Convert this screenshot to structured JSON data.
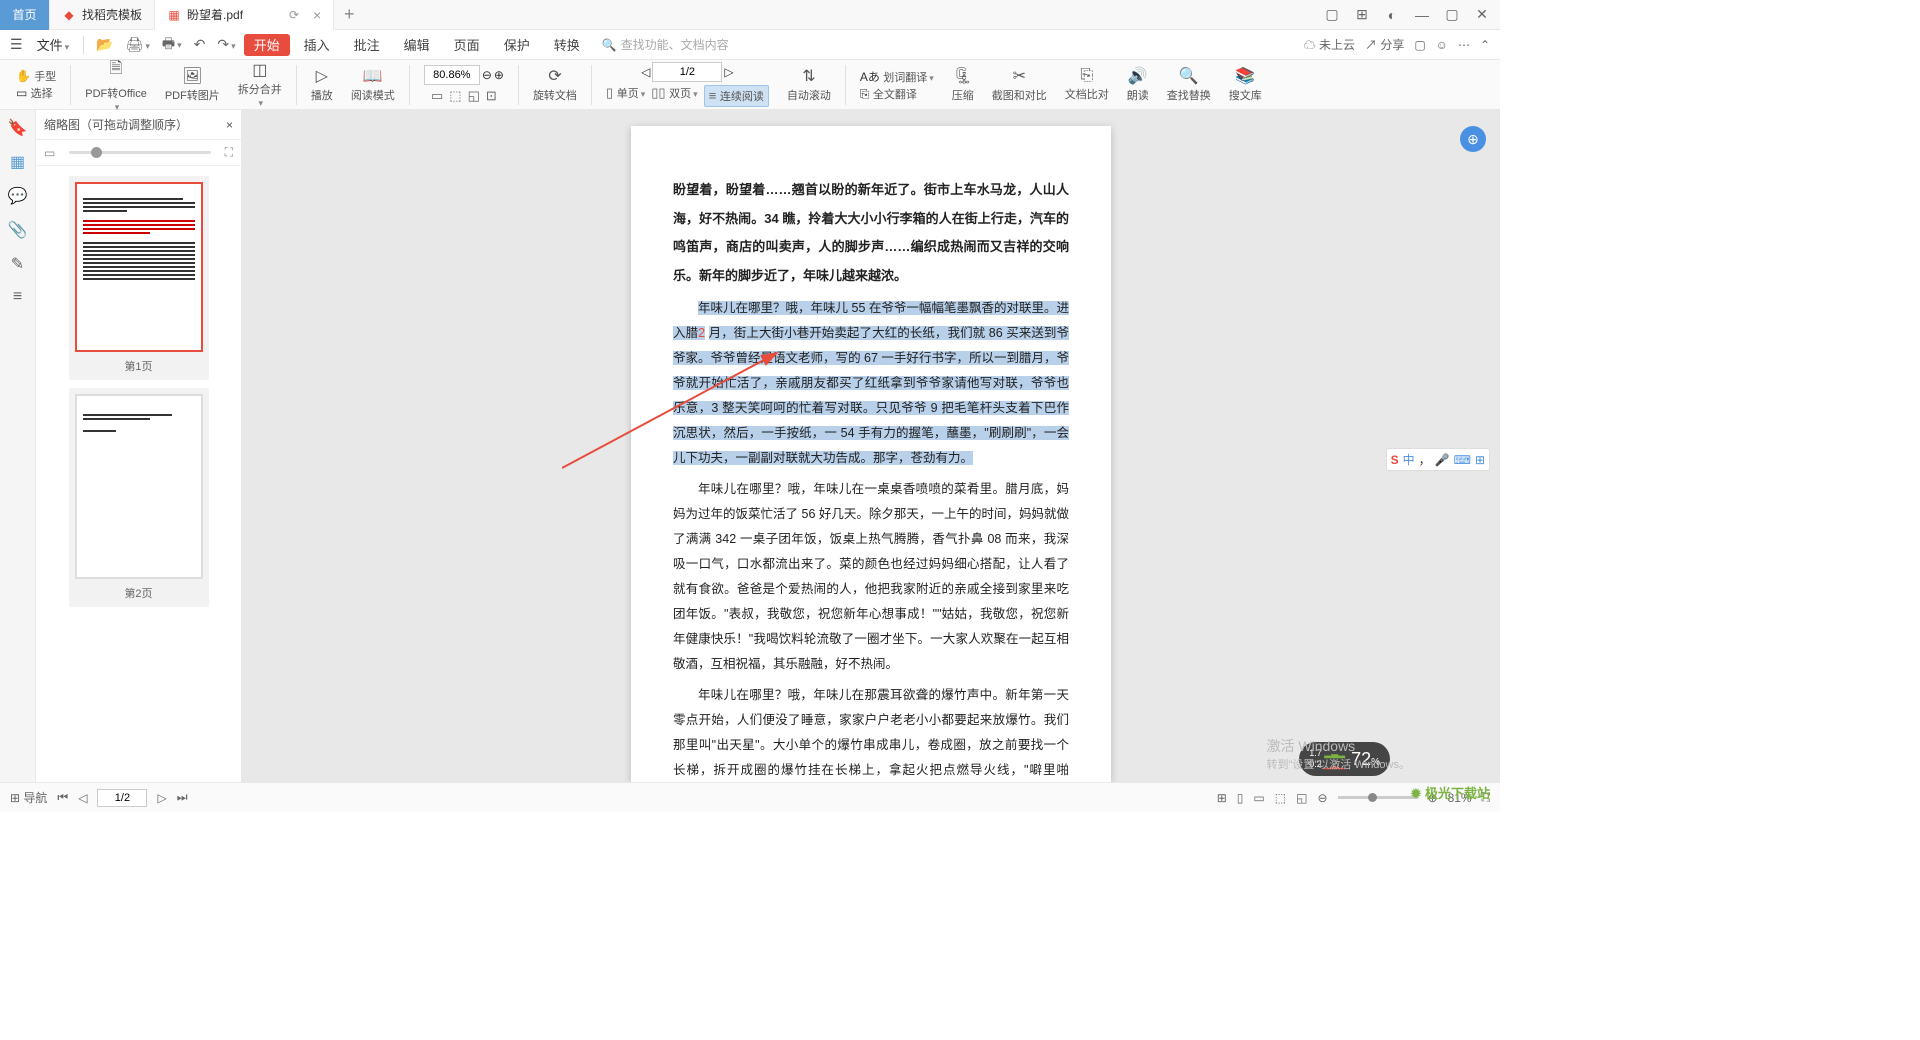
{
  "tabs": {
    "home": "首页",
    "template": "找稻壳模板",
    "doc": "盼望着.pdf"
  },
  "file_label": "文件",
  "menus": {
    "start": "开始",
    "insert": "插入",
    "review": "批注",
    "edit": "编辑",
    "page": "页面",
    "protect": "保护",
    "convert": "转换"
  },
  "search_placeholder": "查找功能、文档内容",
  "right": {
    "cloud": "未上云",
    "share": "分享"
  },
  "tools": {
    "hand": "手型",
    "select": "选择",
    "pdf2office": "PDF转Office",
    "pdf2img": "PDF转图片",
    "split": "拆分合并",
    "play": "播放",
    "readmode": "阅读模式",
    "zoom": "80.86%",
    "rotate": "旋转文档",
    "single": "单页",
    "double": "双页",
    "continuous": "连续阅读",
    "autoscroll": "自动滚动",
    "wordtrans": "划词翻译",
    "fulltrans": "全文翻译",
    "compress": "压缩",
    "screenshot": "截图和对比",
    "textcompare": "文档比对",
    "read": "朗读",
    "findreplace": "查找替换",
    "searchlib": "搜文库",
    "page": "1/2"
  },
  "thumb": {
    "title": "缩略图（可拖动调整顺序）",
    "p1": "第1页",
    "p2": "第2页"
  },
  "doc": {
    "p1": "盼望着，盼望着……翘首以盼的新年近了。街市上车水马龙，人山人海，好不热闹。34 瞧，拎着大大小小行李箱的人在街上行走，汽车的鸣笛声，商店的叫卖声，人的脚步声……编织成热闹而又吉祥的交响乐。新年的脚步近了，年味儿越来越浓。",
    "p2a": "年味儿在哪里？哦，年味儿 55 在爷爷一幅幅笔墨飘香的对联里。进入腊",
    "p2b": "月，街上大街小巷开始卖起了大红的长纸，我们就 86 买来送到爷爷家。爷爷曾经是语文老师，写的 67 一手好行书字，所以一到腊月，爷爷就开始忙活了，亲戚朋友都买了红纸拿到爷爷家请他写对联，爷爷也乐意，3 整天笑呵呵的忙着写对联。只见爷爷 9 把毛笔杆头支着下巴作沉思状，然后，一手按纸，一 54 手有力的握笔，蘸墨，\"刷刷刷\"，一会儿下功夫，一副副对联就大功告成。那字，苍劲有力。",
    "p2_hi_nums": {
      "a": "2",
      "b": "86",
      "c": "67",
      "d": "3",
      "e": "9",
      "f": "54"
    },
    "p3": "年味儿在哪里？哦，年味儿在一桌桌香喷喷的菜肴里。腊月底，妈妈为过年的饭菜忙活了 56 好几天。除夕那天，一上午的时间，妈妈就做了满满 342 一桌子团年饭，饭桌上热气腾腾，香气扑鼻 08 而来，我深吸一口气，口水都流出来了。菜的颜色也经过妈妈细心搭配，让人看了就有食欲。爸爸是个爱热闹的人，他把我家附近的亲戚全接到家里来吃团年饭。\"表叔，我敬您，祝您新年心想事成！\"\"姑姑，我敬您，祝您新年健康快乐！\"我喝饮料轮流敬了一圈才坐下。一大家人欢聚在一起互相敬酒，互相祝福，其乐融融，好不热闹。",
    "p4": "年味儿在哪里？哦，年味儿在那震耳欲聋的爆竹声中。新年第一天零点开始，人们便没了睡意，家家户户老老小小都要起来放爆竹。我们那里叫\"出天星\"。大小单个的爆竹串成串儿，卷成圈，放之前要找一个长梯，拆开成圈的爆竹挂在长梯上，拿起火把点燃导火线，\"噼里啪啦\"响彻云霄。\"出天星\"这一挂鞭主人要挑最大的、最响的，点火把也要烧的最旺的。听爸爸妈妈说讲究的是新年红红火火的好兆头。\"出天星\"后我们还放了直霄云天的烟花，烟花在天空中绽放出五颜六色的花朵。还有能喷出\"喷泉\"的火树银花、旋转\"地雷\"……\"爆竹声声除旧岁\"。不错的，家家户户都用震天动地的爆竹来憧憬新年的期待和喜悦。"
  },
  "status": {
    "nav": "导航",
    "page": "1/2",
    "zoom": "81%"
  },
  "ime": {
    "zh": "中"
  },
  "perf": {
    "cpu": "1.7",
    "mem": "0.2",
    "pct": "72"
  },
  "watermark": {
    "l1": "激活 Windows",
    "l2": "转到\"设置\"以激活 Windows。"
  },
  "logo": "极光下载站"
}
